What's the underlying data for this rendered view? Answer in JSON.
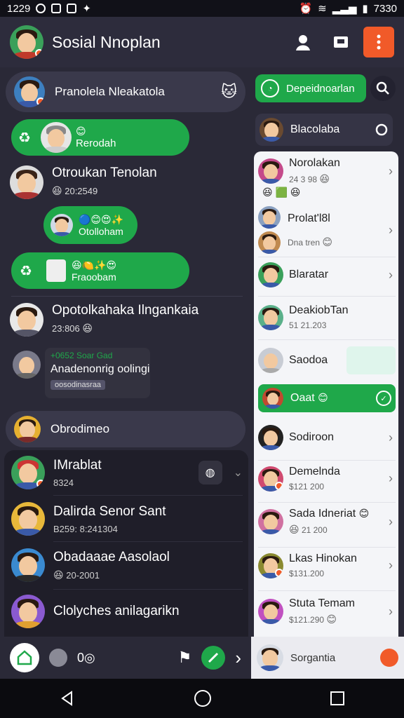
{
  "status_bar": {
    "time_left": "1229",
    "time_right": "7330"
  },
  "app": {
    "title": "Sosial Nnoplan"
  },
  "left": {
    "header_row": {
      "label": "Pranolela Nleakatola"
    },
    "bubble1": {
      "label": "Rerodah"
    },
    "chat1": {
      "name": "Otroukan Tenolan",
      "sub": "20:2549"
    },
    "bubble2": {
      "label": "Otolloham"
    },
    "bubble3": {
      "label": "Fraoobam"
    },
    "chat2": {
      "name": "Opotolkahaka Ilngankaia",
      "sub": "23:806",
      "tag": "+0652 Soar Gad",
      "message": "Anadenonrig oolingi",
      "chip": "oosodinasraa"
    },
    "group_row": {
      "label": "Obrodimeo"
    },
    "dark_list": [
      {
        "name": "IMrablat",
        "sub": "8324"
      },
      {
        "name": "Dalirda Senor Sant",
        "sub": "B259: 8:241304"
      },
      {
        "name": "Obadaaae Aasolaol",
        "sub": "20-2001"
      },
      {
        "name": "Clolyches anilagarikn",
        "sub": ""
      }
    ]
  },
  "right": {
    "search_label": "Depeidnoarlan",
    "filter_label": "Blacolaba",
    "items": [
      {
        "name": "Norolakan",
        "sub": "24 3 98"
      },
      {
        "name": "Prolat'l8l",
        "sub": "Dna tren"
      },
      {
        "name": "Blaratar",
        "sub": ""
      },
      {
        "name": "DeakiobTan",
        "sub": "51 21.203"
      },
      {
        "name": "Saodoa",
        "sub": ""
      },
      {
        "name": "Oaat",
        "sub": ""
      },
      {
        "name": "Sodiroon",
        "sub": ""
      },
      {
        "name": "Demelnda",
        "sub": "$121 200"
      },
      {
        "name": "Sada Idneriat",
        "sub": "21 200"
      },
      {
        "name": "Lkas Hinokan",
        "sub": "$131.200"
      },
      {
        "name": "Stuta Temam",
        "sub": "$121.290"
      }
    ],
    "bottom_label": "Sorgantia"
  },
  "colors": {
    "green": "#1fa84a",
    "orange": "#f15a29",
    "bg": "#2a2937"
  }
}
